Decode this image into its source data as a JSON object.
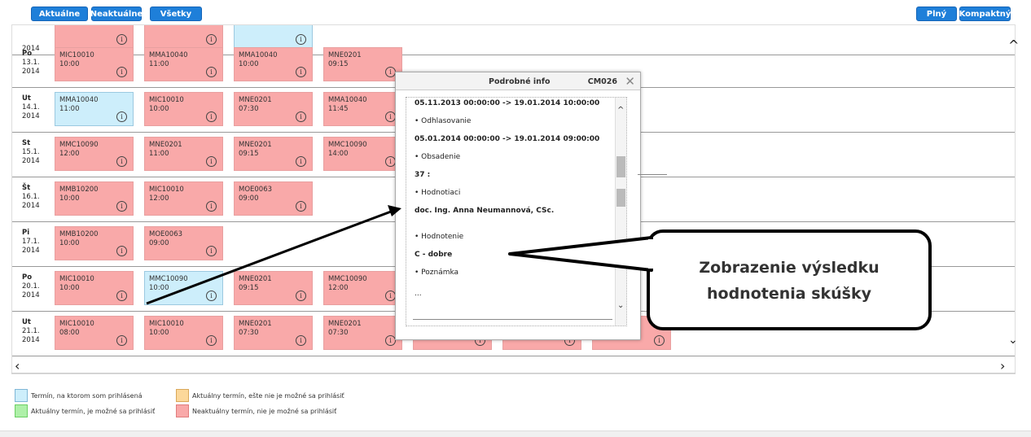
{
  "toolbar": {
    "aktualne": "Aktuálne",
    "neaktualne": "Neaktuálne",
    "vsetky": "Všetky",
    "plny": "Plný",
    "kompaktny": "Kompaktný"
  },
  "rows": [
    {
      "day": "",
      "date": "",
      "year": "2014",
      "cells": [
        {
          "code": "",
          "time": "",
          "color": "red"
        },
        {
          "code": "",
          "time": "",
          "color": "red"
        },
        {
          "code": "",
          "time": "",
          "color": "blue"
        }
      ]
    },
    {
      "day": "Po",
      "date": "13.1.",
      "year": "2014",
      "cells": [
        {
          "code": "MIC10010",
          "time": "10:00",
          "color": "red"
        },
        {
          "code": "MMA10040",
          "time": "11:00",
          "color": "red"
        },
        {
          "code": "MMA10040",
          "time": "10:00",
          "color": "red"
        },
        {
          "code": "MNE0201",
          "time": "09:15",
          "color": "red"
        }
      ]
    },
    {
      "day": "Ut",
      "date": "14.1.",
      "year": "2014",
      "cells": [
        {
          "code": "MMA10040",
          "time": "11:00",
          "color": "blue"
        },
        {
          "code": "MIC10010",
          "time": "10:00",
          "color": "red"
        },
        {
          "code": "MNE0201",
          "time": "07:30",
          "color": "red"
        },
        {
          "code": "MMA10040",
          "time": "11:45",
          "color": "red"
        }
      ]
    },
    {
      "day": "St",
      "date": "15.1.",
      "year": "2014",
      "cells": [
        {
          "code": "MMC10090",
          "time": "12:00",
          "color": "red"
        },
        {
          "code": "MNE0201",
          "time": "11:00",
          "color": "red"
        },
        {
          "code": "MNE0201",
          "time": "09:15",
          "color": "red"
        },
        {
          "code": "MMC10090",
          "time": "14:00",
          "color": "red"
        }
      ]
    },
    {
      "day": "Št",
      "date": "16.1.",
      "year": "2014",
      "cells": [
        {
          "code": "MMB10200",
          "time": "10:00",
          "color": "red"
        },
        {
          "code": "MIC10010",
          "time": "12:00",
          "color": "red"
        },
        {
          "code": "MOE0063",
          "time": "09:00",
          "color": "red"
        }
      ]
    },
    {
      "day": "Pi",
      "date": "17.1.",
      "year": "2014",
      "cells": [
        {
          "code": "MMB10200",
          "time": "10:00",
          "color": "red"
        },
        {
          "code": "MOE0063",
          "time": "09:00",
          "color": "red"
        }
      ]
    },
    {
      "day": "Po",
      "date": "20.1.",
      "year": "2014",
      "cells": [
        {
          "code": "MIC10010",
          "time": "10:00",
          "color": "red"
        },
        {
          "code": "MMC10090",
          "time": "10:00",
          "color": "blue"
        },
        {
          "code": "MNE0201",
          "time": "09:15",
          "color": "red"
        },
        {
          "code": "MMC10090",
          "time": "12:00",
          "color": "red"
        }
      ]
    },
    {
      "day": "Ut",
      "date": "21.1.",
      "year": "2014",
      "cells": [
        {
          "code": "MIC10010",
          "time": "08:00",
          "color": "red"
        },
        {
          "code": "MIC10010",
          "time": "10:00",
          "color": "red"
        },
        {
          "code": "MNE0201",
          "time": "07:30",
          "color": "red"
        },
        {
          "code": "MNE0201",
          "time": "07:30",
          "color": "red"
        },
        {
          "code": "",
          "time": "",
          "color": "red"
        },
        {
          "code": "",
          "time": "",
          "color": "red"
        },
        {
          "code": "",
          "time": "",
          "color": "red"
        }
      ]
    }
  ],
  "popup": {
    "title": "Podrobné info",
    "code": "CM026",
    "lines": [
      "05.11.2013 00:00:00 -> 19.01.2014 10:00:00",
      "• Odhlasovanie",
      "05.01.2014 00:00:00 -> 19.01.2014 09:00:00",
      "• Obsadenie",
      "37 :",
      "• Hodnotiaci",
      "doc. Ing. Anna Neumannová, CSc.",
      "• Hodnotenie",
      "C - dobre",
      "• Poznámka",
      "..."
    ]
  },
  "callout": {
    "line1": "Zobrazenie výsledku",
    "line2": "hodnotenia skúšky"
  },
  "legend": {
    "blue": "Termín, na ktorom som prihlásená",
    "orange": "Aktuálny termín, ešte nie je možné sa prihlásiť",
    "green": "Aktuálny termín, je možné sa prihlásiť",
    "red": "Neaktuálny termín, nie je možné sa prihlásiť"
  },
  "colors": {
    "red": "#f9a9a9",
    "blue": "#cdeefb",
    "orange": "#fcd89a",
    "green": "#aef0a8",
    "accent": "#1e7fd9"
  }
}
